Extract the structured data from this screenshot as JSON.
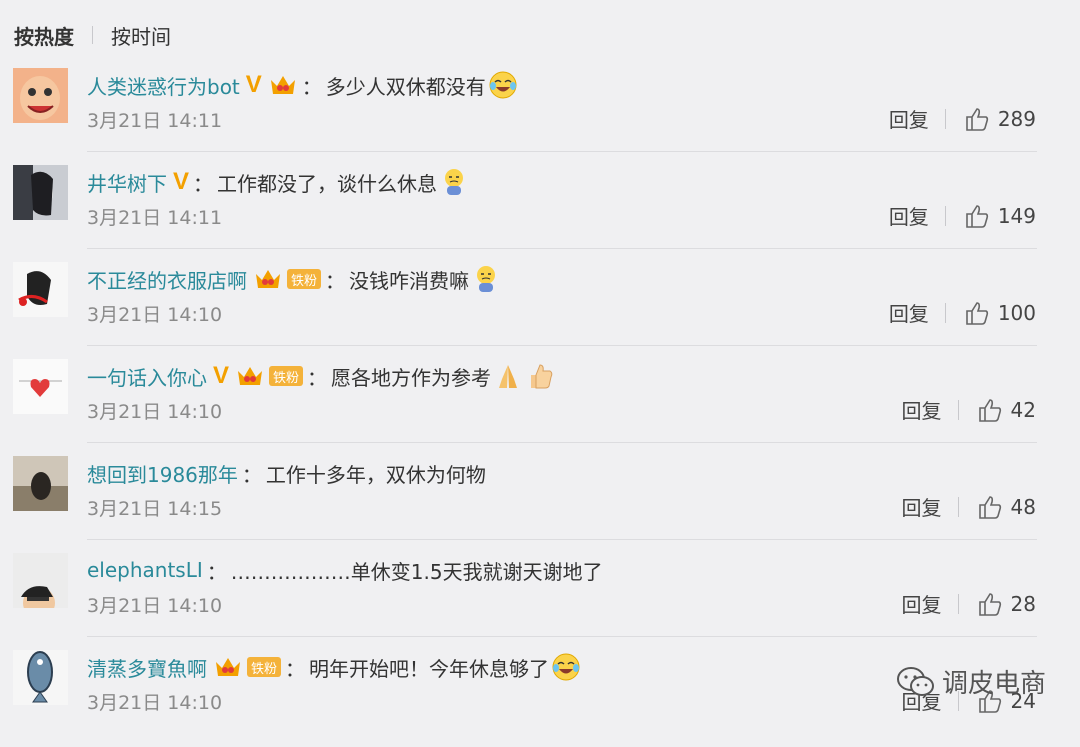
{
  "sort": {
    "hot": "按热度",
    "time": "按时间"
  },
  "comments": [
    {
      "user": "人类迷惑行为bot",
      "v": "V",
      "fan": "",
      "colon": "：",
      "text": "多少人双休都没有",
      "date": "3月21日 14:11",
      "reply": "回复",
      "likes": "289"
    },
    {
      "user": "井华树下",
      "v": "V",
      "fan": "",
      "colon": "：",
      "text": "工作都没了，谈什么休息",
      "date": "3月21日 14:11",
      "reply": "回复",
      "likes": "149"
    },
    {
      "user": "不正经的衣服店啊",
      "v": "",
      "fan": "铁粉",
      "colon": "：",
      "text": "没钱咋消费嘛",
      "date": "3月21日 14:10",
      "reply": "回复",
      "likes": "100"
    },
    {
      "user": "一句话入你心",
      "v": "V",
      "fan": "铁粉",
      "colon": "：",
      "text": "愿各地方作为参考",
      "date": "3月21日 14:10",
      "reply": "回复",
      "likes": "42"
    },
    {
      "user": "想回到1986那年",
      "v": "",
      "fan": "",
      "colon": "：",
      "text": "工作十多年，双休为何物",
      "date": "3月21日 14:15",
      "reply": "回复",
      "likes": "48"
    },
    {
      "user": "elephantsLI",
      "v": "",
      "fan": "",
      "colon": "：",
      "text": "………………单休变1.5天我就谢天谢地了",
      "date": "3月21日 14:10",
      "reply": "回复",
      "likes": "28"
    },
    {
      "user": "清蒸多寶魚啊",
      "v": "",
      "fan": "铁粉",
      "colon": "：",
      "text": "明年开始吧！今年休息够了",
      "date": "3月21日 14:10",
      "reply": "回复",
      "likes": "24"
    }
  ],
  "watermark": {
    "text": "调皮电商"
  },
  "colors": {
    "username": "#2a8a9a",
    "vip": "#f3a000",
    "fan_badge": "#f4b23a",
    "background": "#f0f0f2"
  }
}
